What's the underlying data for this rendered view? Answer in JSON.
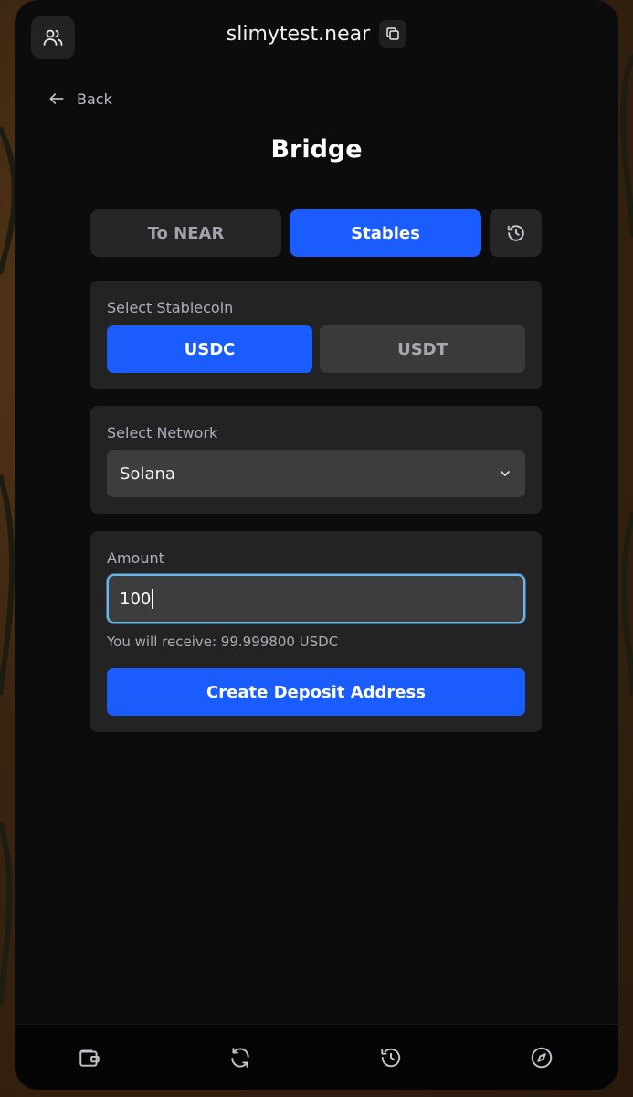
{
  "header": {
    "account_name": "slimytest.near"
  },
  "nav": {
    "back_label": "Back"
  },
  "page": {
    "title": "Bridge"
  },
  "tabs": [
    {
      "label": "To NEAR",
      "active": false
    },
    {
      "label": "Stables",
      "active": true
    }
  ],
  "stablecoin": {
    "label": "Select Stablecoin",
    "options": [
      {
        "label": "USDC",
        "selected": true
      },
      {
        "label": "USDT",
        "selected": false
      }
    ]
  },
  "network": {
    "label": "Select Network",
    "selected": "Solana"
  },
  "amount": {
    "label": "Amount",
    "value": "100",
    "receive_text": "You will receive: 99.999800 USDC"
  },
  "cta": {
    "label": "Create Deposit Address"
  },
  "bottom_nav": {
    "icons": [
      "wallet-icon",
      "swap-icon",
      "history-icon",
      "compass-icon"
    ]
  },
  "colors": {
    "accent": "#1b5cff",
    "background": "#0c0c0c",
    "card": "#232323",
    "input_focus": "#6fb6e8"
  }
}
